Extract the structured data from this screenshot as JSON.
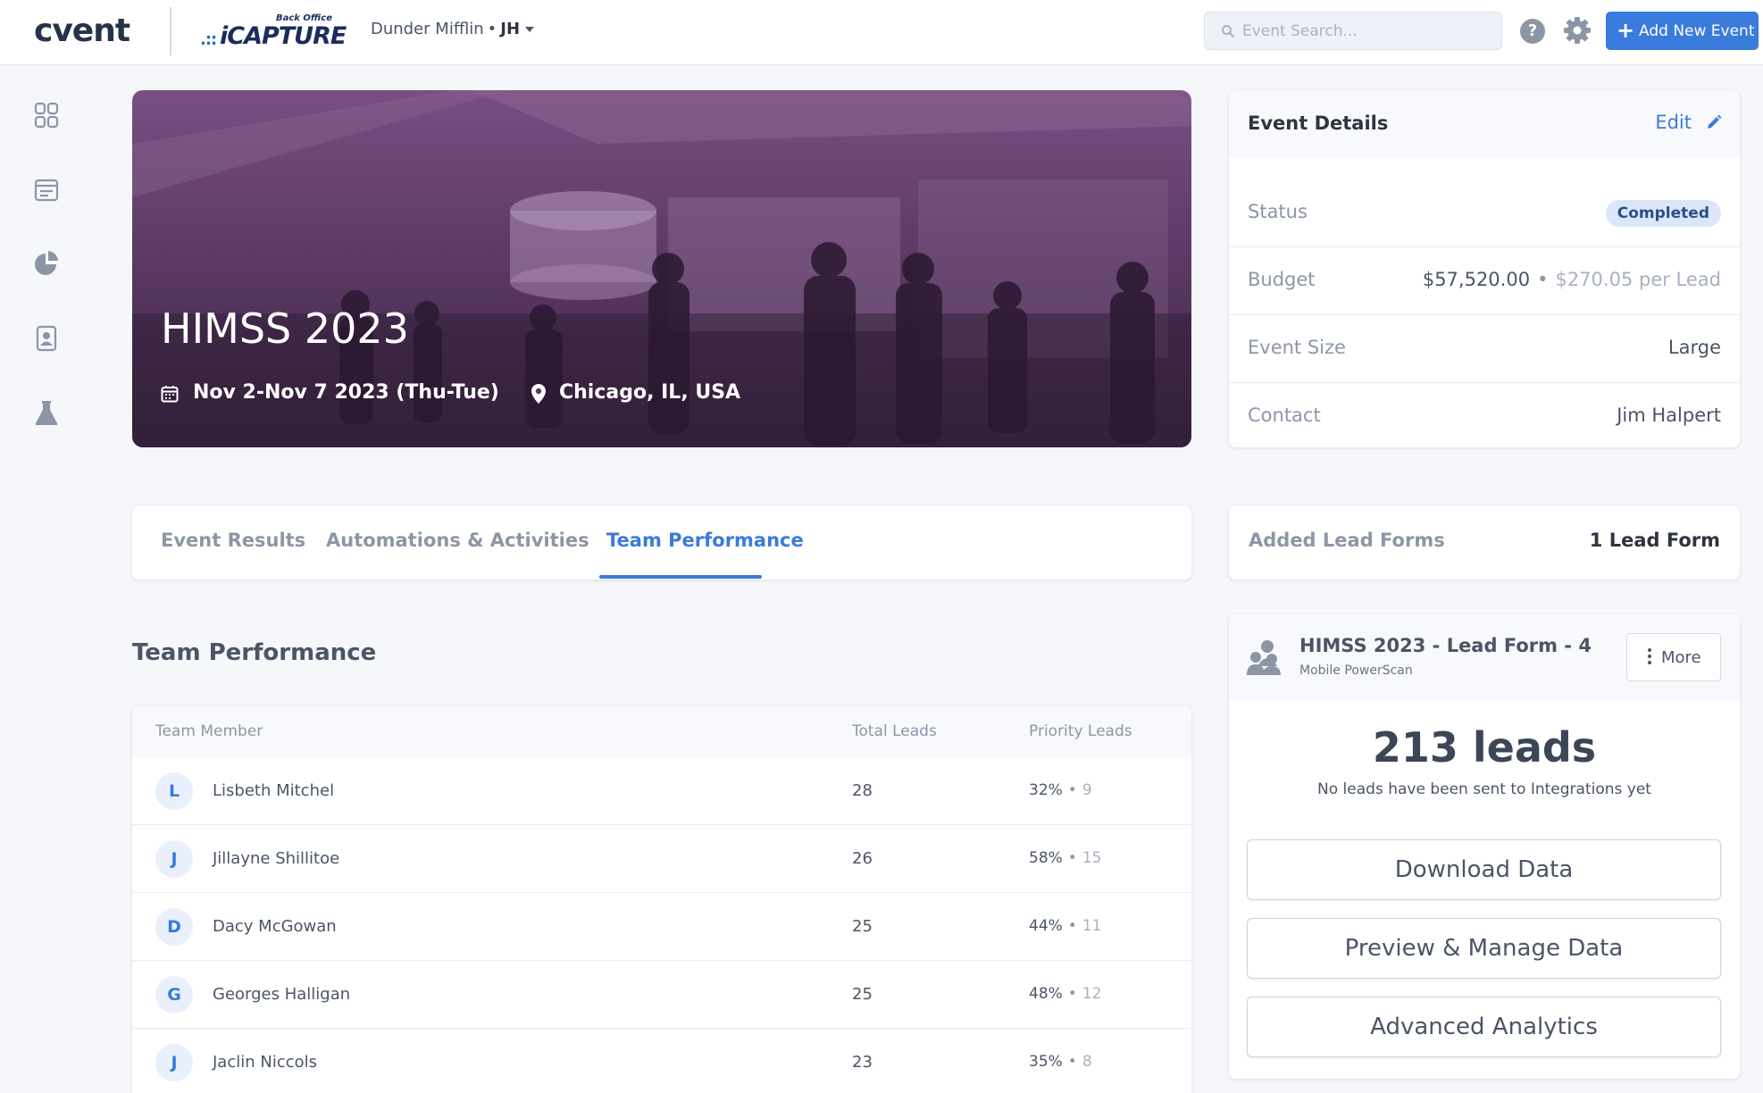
{
  "brand": {
    "logo": "cvent",
    "product_tag": "Back Office",
    "product": "iCAPTURE"
  },
  "account": {
    "org": "Dunder Mifflin",
    "separator": "•",
    "initials": "JH"
  },
  "search": {
    "placeholder": "Event Search..."
  },
  "header_actions": {
    "help": "?",
    "add_event": "Add New Event"
  },
  "sidebar": {
    "items": [
      {
        "icon": "dashboard-grid-icon"
      },
      {
        "icon": "calendar-list-icon"
      },
      {
        "icon": "pie-chart-icon"
      },
      {
        "icon": "contact-card-icon"
      },
      {
        "icon": "lab-flask-icon"
      }
    ]
  },
  "event": {
    "title": "HIMSS 2023",
    "dates": "Nov 2-Nov 7 2023 (Thu-Tue)",
    "location": "Chicago, IL, USA"
  },
  "details": {
    "title": "Event Details",
    "edit": "Edit",
    "status_label": "Status",
    "status_value": "Completed",
    "budget_label": "Budget",
    "budget_value": "$57,520.00",
    "budget_sep": "•",
    "budget_per_lead": "$270.05 per Lead",
    "size_label": "Event Size",
    "size_value": "Large",
    "contact_label": "Contact",
    "contact_value": "Jim Halpert"
  },
  "tabs": [
    {
      "label": "Event Results"
    },
    {
      "label": "Automations & Activities"
    },
    {
      "label": "Team Performance",
      "active": true
    }
  ],
  "lead_forms": {
    "label": "Added Lead Forms",
    "value": "1 Lead Form"
  },
  "team": {
    "section_title": "Team Performance",
    "columns": {
      "member": "Team Member",
      "total": "Total Leads",
      "priority": "Priority Leads"
    },
    "rows": [
      {
        "initial": "L",
        "name": "Lisbeth Mitchel",
        "total": "28",
        "priority_pct": "32%",
        "sep": "•",
        "priority_count": "9"
      },
      {
        "initial": "J",
        "name": "Jillayne Shillitoe",
        "total": "26",
        "priority_pct": "58%",
        "sep": "•",
        "priority_count": "15"
      },
      {
        "initial": "D",
        "name": "Dacy McGowan",
        "total": "25",
        "priority_pct": "44%",
        "sep": "•",
        "priority_count": "11"
      },
      {
        "initial": "G",
        "name": "Georges Halligan",
        "total": "25",
        "priority_pct": "48%",
        "sep": "•",
        "priority_count": "12"
      },
      {
        "initial": "J",
        "name": "Jaclin Niccols",
        "total": "23",
        "priority_pct": "35%",
        "sep": "•",
        "priority_count": "8"
      }
    ]
  },
  "lead_form": {
    "title": "HIMSS 2023 - Lead Form - 4",
    "subtitle": "Mobile PowerScan",
    "more": "More",
    "count": "213 leads",
    "note": "No leads have been sent to Integrations yet",
    "buttons": [
      "Download Data",
      "Preview & Manage Data",
      "Advanced Analytics"
    ]
  },
  "colors": {
    "accent": "#3a7bdb",
    "hero_tint": "#6b4474",
    "badge_bg": "#dbe7f8"
  }
}
